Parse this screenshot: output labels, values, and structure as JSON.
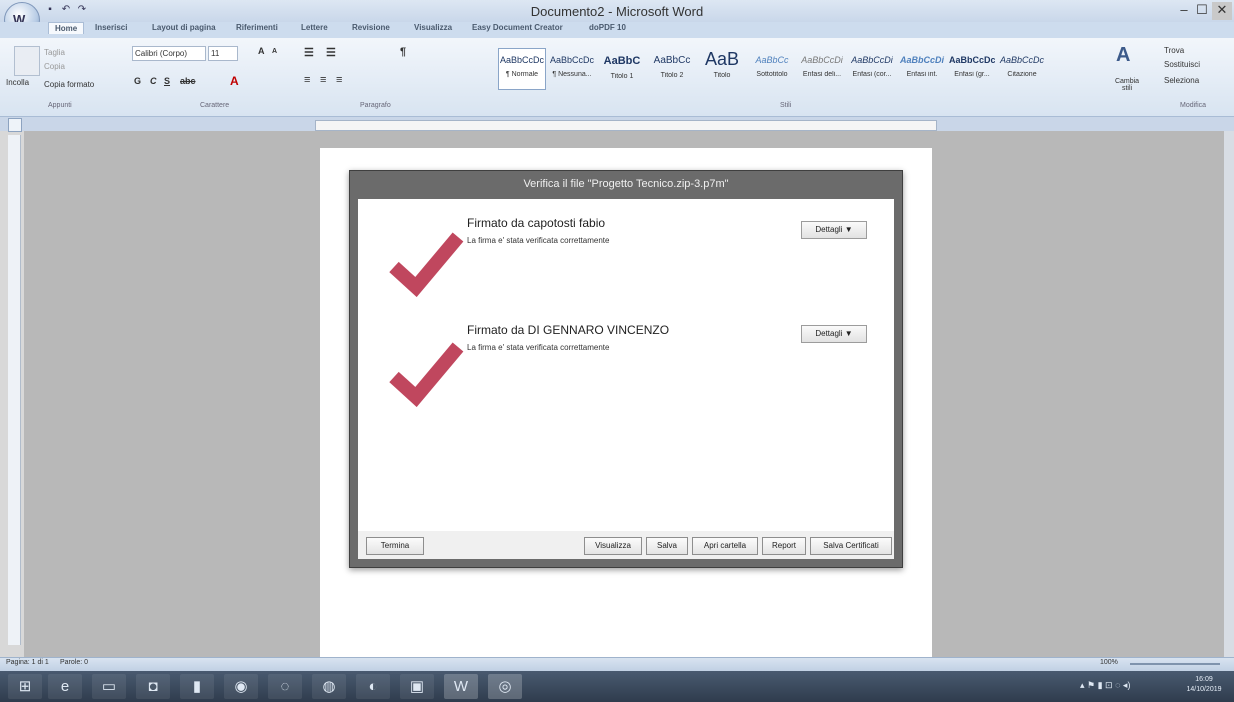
{
  "window": {
    "title": "Documento2 - Microsoft Word",
    "minimize": "–",
    "maximize": "☐",
    "close": "✕"
  },
  "ribbon": {
    "tabs": [
      "Home",
      "Inserisci",
      "Layout di pagina",
      "Riferimenti",
      "Lettere",
      "Revisione",
      "Visualizza",
      "Easy Document Creator",
      "doPDF 10"
    ],
    "clipboard": {
      "paste": "Incolla",
      "cut": "Taglia",
      "copy": "Copia",
      "format_painter": "Copia formato",
      "label": "Appunti"
    },
    "font": {
      "name": "Calibri (Corpo)",
      "size": "11",
      "label": "Carattere"
    },
    "paragraph": {
      "label": "Paragrafo"
    },
    "styles": {
      "label": "Stili",
      "items": [
        {
          "sample": "AaBbCcDc",
          "name": "¶ Normale"
        },
        {
          "sample": "AaBbCcDc",
          "name": "¶ Nessuna..."
        },
        {
          "sample": "AaBbC",
          "name": "Titolo 1"
        },
        {
          "sample": "AaBbCc",
          "name": "Titolo 2"
        },
        {
          "sample": "AaB",
          "name": "Titolo"
        },
        {
          "sample": "AaBbCc",
          "name": "Sottotitolo"
        },
        {
          "sample": "AaBbCcDi",
          "name": "Enfasi deli..."
        },
        {
          "sample": "AaBbCcDi",
          "name": "Enfasi (cor..."
        },
        {
          "sample": "AaBbCcDi",
          "name": "Enfasi int."
        },
        {
          "sample": "AaBbCcDc",
          "name": "Enfasi (gr..."
        },
        {
          "sample": "AaBbCcDc",
          "name": "Citazione"
        }
      ],
      "change_styles": "Cambia stili"
    },
    "editing": {
      "find": "Trova",
      "replace": "Sostituisci",
      "select": "Seleziona",
      "label": "Modifica"
    }
  },
  "dialog": {
    "title": "Verifica il file \"Progetto Tecnico.zip-3.p7m\"",
    "signatures": [
      {
        "name": "Firmato da capotosti fabio",
        "status": "La firma e' stata verificata correttamente",
        "details": "Dettagli ▼"
      },
      {
        "name": "Firmato da DI GENNARO VINCENZO",
        "status": "La firma e' stata verificata correttamente",
        "details": "Dettagli ▼"
      }
    ],
    "buttons": {
      "close": "Termina",
      "view": "Visualizza",
      "save": "Salva",
      "open_folder": "Apri cartella",
      "report": "Report",
      "save_certs": "Salva Certificati"
    }
  },
  "statusbar": {
    "page": "Pagina: 1 di 1",
    "words": "Parole: 0",
    "zoom": "100%"
  },
  "taskbar": {
    "clock_time": "16:09",
    "clock_date": "14/10/2019"
  },
  "colors": {
    "checkmark": "#c0475e",
    "dialog_frame": "#6b6b6b"
  }
}
